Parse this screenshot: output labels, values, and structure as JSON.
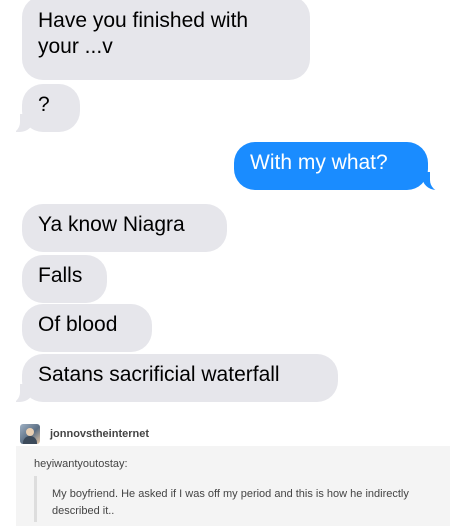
{
  "messages": [
    {
      "side": "in",
      "text_line1": "Have you finished with",
      "text_line2": "your ...v"
    },
    {
      "side": "in",
      "text": "?"
    },
    {
      "side": "out",
      "text": "With my what?"
    },
    {
      "side": "in",
      "text": "Ya know Niagra"
    },
    {
      "side": "in",
      "text": "Falls"
    },
    {
      "side": "in",
      "text": "Of blood"
    },
    {
      "side": "in",
      "text": "Satans sacrificial waterfall"
    }
  ],
  "post": {
    "username": "jonnovstheinternet",
    "reblogged_from": "heyiwantyoutostay:",
    "quote_line1": "My boyfriend. He asked if I was off my period and this is how he indirectly",
    "quote_line2": "described it.."
  },
  "colors": {
    "incoming_bubble": "#e6e6eb",
    "outgoing_bubble": "#1a8cff",
    "post_background": "#f4f4f4"
  }
}
